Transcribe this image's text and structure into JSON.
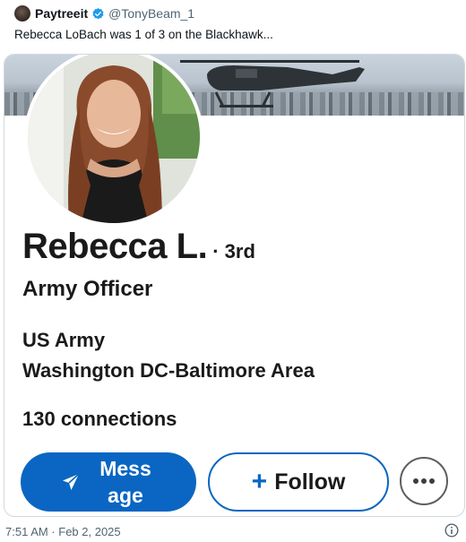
{
  "tweet": {
    "author_name": "Paytreeit",
    "handle": "@TonyBeam_1",
    "text": "Rebecca LoBach was 1 of 3 on the Blackhawk...",
    "timestamp": "7:51 AM · Feb 2, 2025",
    "verified_color": "#1d9bf0"
  },
  "profile": {
    "name": "Rebecca L.",
    "degree": "· 3rd",
    "headline": "Army Officer",
    "company": "US Army",
    "location": "Washington DC-Baltimore Area",
    "connections": "130 connections",
    "accent_color": "#0a66c2"
  },
  "actions": {
    "message_label": "Message",
    "follow_plus": "+",
    "follow_label": "Follow"
  },
  "icons": {
    "verified": "verified-check-icon",
    "send": "send-icon",
    "more": "more-dots-icon",
    "info": "info-icon"
  }
}
